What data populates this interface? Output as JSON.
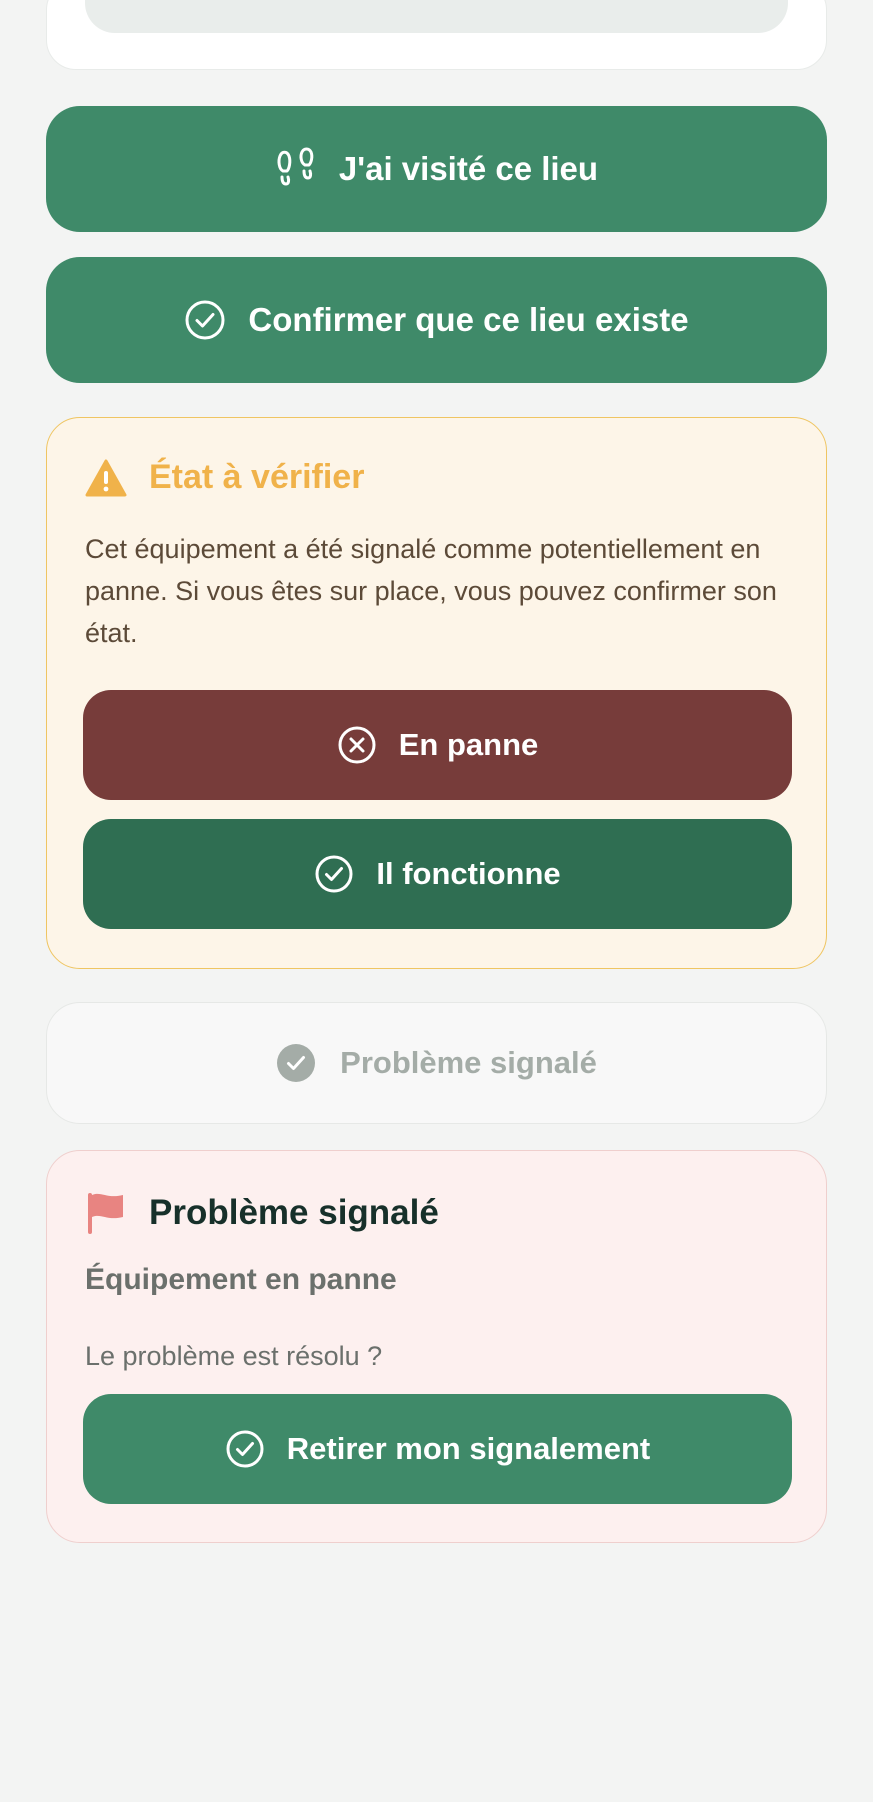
{
  "buttons": {
    "visited": "J'ai visité ce lieu",
    "confirm_exists": "Confirmer que ce lieu existe"
  },
  "warning": {
    "title": "État à vérifier",
    "text": "Cet équipement a été signalé comme potentiellement en panne. Si vous êtes sur place, vous pouvez confirmer son état.",
    "broken_label": "En panne",
    "working_label": "Il fonctionne"
  },
  "reported_status": {
    "label": "Problème signalé"
  },
  "problem": {
    "title": "Problème signalé",
    "subtitle": "Équipement en panne",
    "question": "Le problème est résolu ?",
    "withdraw_label": "Retirer mon signalement"
  },
  "colors": {
    "primary_green": "#3f8a69",
    "dark_green": "#2f6e52",
    "danger_red": "#773c3a",
    "warning_amber": "#f0b24a",
    "flag_red": "#e88481"
  },
  "icons": {
    "visited": "footprints-icon",
    "confirm": "check-circle-icon",
    "warning": "warning-triangle-icon",
    "broken": "x-circle-icon",
    "working": "check-circle-icon",
    "reported": "check-circle-filled-icon",
    "problem": "flag-icon",
    "withdraw": "check-circle-icon"
  }
}
